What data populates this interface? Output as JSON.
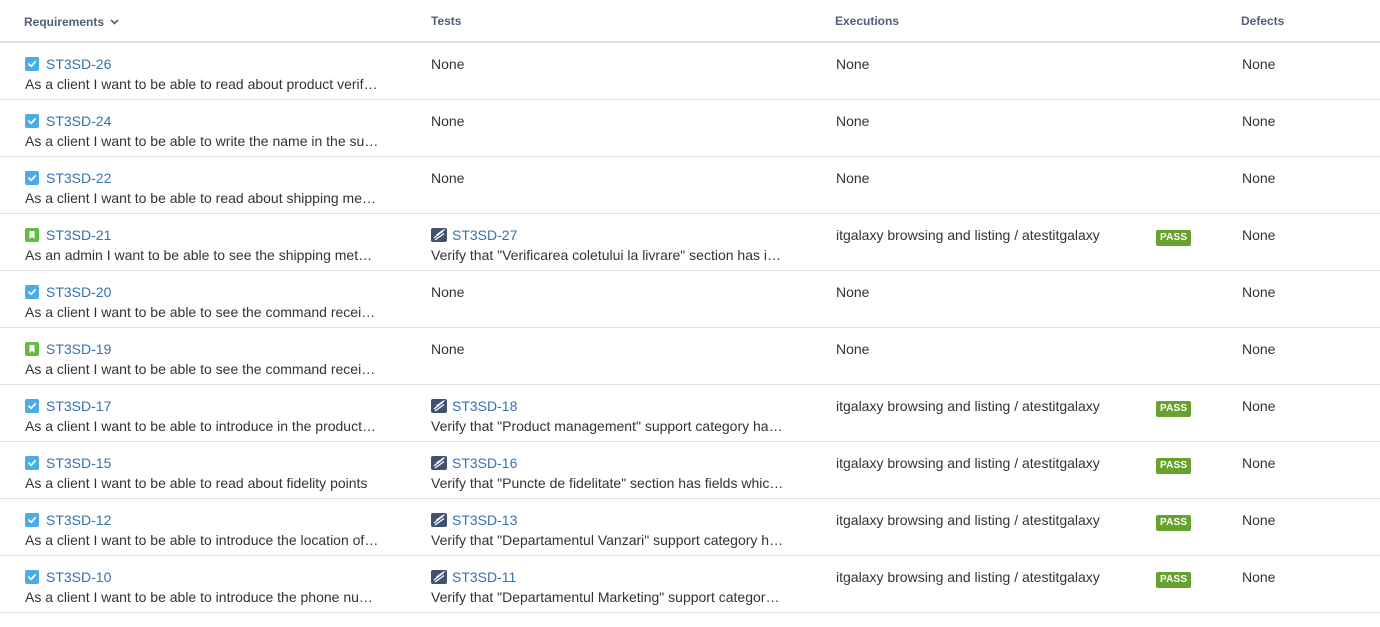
{
  "colors": {
    "link": "#3572b0",
    "header_text": "#505f79",
    "pass": "#66a22d",
    "story_icon": "#65ba43",
    "task_icon": "#4bade8",
    "test_icon": "#42526e",
    "row_border": "#dfe1e6"
  },
  "header": {
    "requirements": "Requirements",
    "tests": "Tests",
    "executions": "Executions",
    "defects": "Defects"
  },
  "rows": [
    {
      "req_icon": "task-icon",
      "req_key": "ST3SD-26",
      "req_summary": "As a client I want to be able to read about product verification",
      "test_key": "",
      "test_summary": "",
      "tests_none": "None",
      "execution": "None",
      "status": "",
      "defects": "None"
    },
    {
      "req_icon": "task-icon",
      "req_key": "ST3SD-24",
      "req_summary": "As a client I want to be able to write the name in the support form",
      "test_key": "",
      "test_summary": "",
      "tests_none": "None",
      "execution": "None",
      "status": "",
      "defects": "None"
    },
    {
      "req_icon": "task-icon",
      "req_key": "ST3SD-22",
      "req_summary": "As a client I want to be able to read about shipping methods",
      "test_key": "",
      "test_summary": "",
      "tests_none": "None",
      "execution": "None",
      "status": "",
      "defects": "None"
    },
    {
      "req_icon": "story-icon",
      "req_key": "ST3SD-21",
      "req_summary": "As an admin I want to be able to see the shipping methods list",
      "test_key": "ST3SD-27",
      "test_summary": "Verify that \"Verificarea coletului la livrare\" section has information",
      "tests_none": "",
      "execution": "itgalaxy browsing and listing / atestitgalaxy",
      "status": "PASS",
      "defects": "None"
    },
    {
      "req_icon": "task-icon",
      "req_key": "ST3SD-20",
      "req_summary": "As a client I want to be able to see the command received page",
      "test_key": "",
      "test_summary": "",
      "tests_none": "None",
      "execution": "None",
      "status": "",
      "defects": "None"
    },
    {
      "req_icon": "story-icon",
      "req_key": "ST3SD-19",
      "req_summary": "As a client I want to be able to see the command received email",
      "test_key": "",
      "test_summary": "",
      "tests_none": "None",
      "execution": "None",
      "status": "",
      "defects": "None"
    },
    {
      "req_icon": "task-icon",
      "req_key": "ST3SD-17",
      "req_summary": "As a client I want to be able to introduce in the product management form",
      "test_key": "ST3SD-18",
      "test_summary": "Verify that \"Product management\" support category has fields",
      "tests_none": "",
      "execution": "itgalaxy browsing and listing / atestitgalaxy",
      "status": "PASS",
      "defects": "None"
    },
    {
      "req_icon": "task-icon",
      "req_key": "ST3SD-15",
      "req_summary": "As a client I want to be able to read about fidelity points",
      "test_key": "ST3SD-16",
      "test_summary": "Verify that \"Puncte de fidelitate\" section has fields which are visible",
      "tests_none": "",
      "execution": "itgalaxy browsing and listing / atestitgalaxy",
      "status": "PASS",
      "defects": "None"
    },
    {
      "req_icon": "task-icon",
      "req_key": "ST3SD-12",
      "req_summary": "As a client I want to be able to introduce the location of the order",
      "test_key": "ST3SD-13",
      "test_summary": "Verify that \"Departamentul Vanzari\" support category has fields",
      "tests_none": "",
      "execution": "itgalaxy browsing and listing / atestitgalaxy",
      "status": "PASS",
      "defects": "None"
    },
    {
      "req_icon": "task-icon",
      "req_key": "ST3SD-10",
      "req_summary": "As a client I want to be able to introduce the phone number in the form",
      "test_key": "ST3SD-11",
      "test_summary": "Verify that \"Departamentul Marketing\" support category has fields",
      "tests_none": "",
      "execution": "itgalaxy browsing and listing / atestitgalaxy",
      "status": "PASS",
      "defects": "None"
    }
  ]
}
